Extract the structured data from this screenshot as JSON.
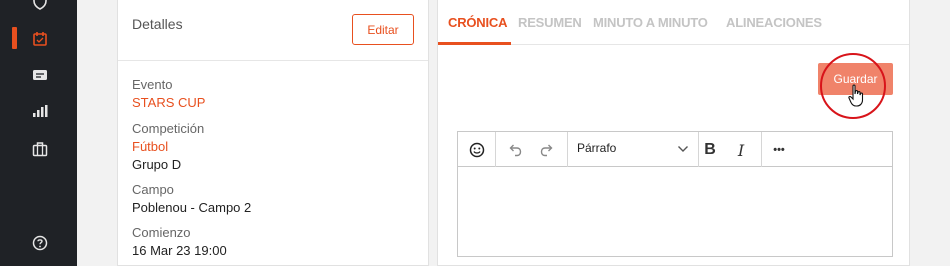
{
  "sidebar": {
    "icons": [
      "shield-icon",
      "calendar-icon",
      "ticket-icon",
      "stats-icon",
      "briefcase-icon",
      "help-icon"
    ],
    "active_color": "#e8501f"
  },
  "details": {
    "title": "Detalles",
    "edit_label": "Editar",
    "fields": {
      "event_label": "Evento",
      "event_value": "STARS CUP",
      "competition_label": "Competición",
      "competition_value": "Fútbol",
      "group_value": "Grupo D",
      "field_label": "Campo",
      "field_value": "Poblenou - Campo 2",
      "start_label": "Comienzo",
      "start_value": "16 Mar 23 19:00"
    }
  },
  "main": {
    "tabs": [
      {
        "label": "CRÓNICA",
        "active": true
      },
      {
        "label": "RESUMEN",
        "active": false
      },
      {
        "label": "MINUTO A MINUTO",
        "active": false
      },
      {
        "label": "ALINEACIONES",
        "active": false
      }
    ],
    "save_label": "Guardar",
    "editor": {
      "format_value": "Párrafo",
      "bold_label": "B",
      "italic_label": "I",
      "more_label": "•••"
    }
  },
  "colors": {
    "accent": "#e8501f",
    "save_button": "#f0836a",
    "sidebar_bg": "#1f2226"
  }
}
